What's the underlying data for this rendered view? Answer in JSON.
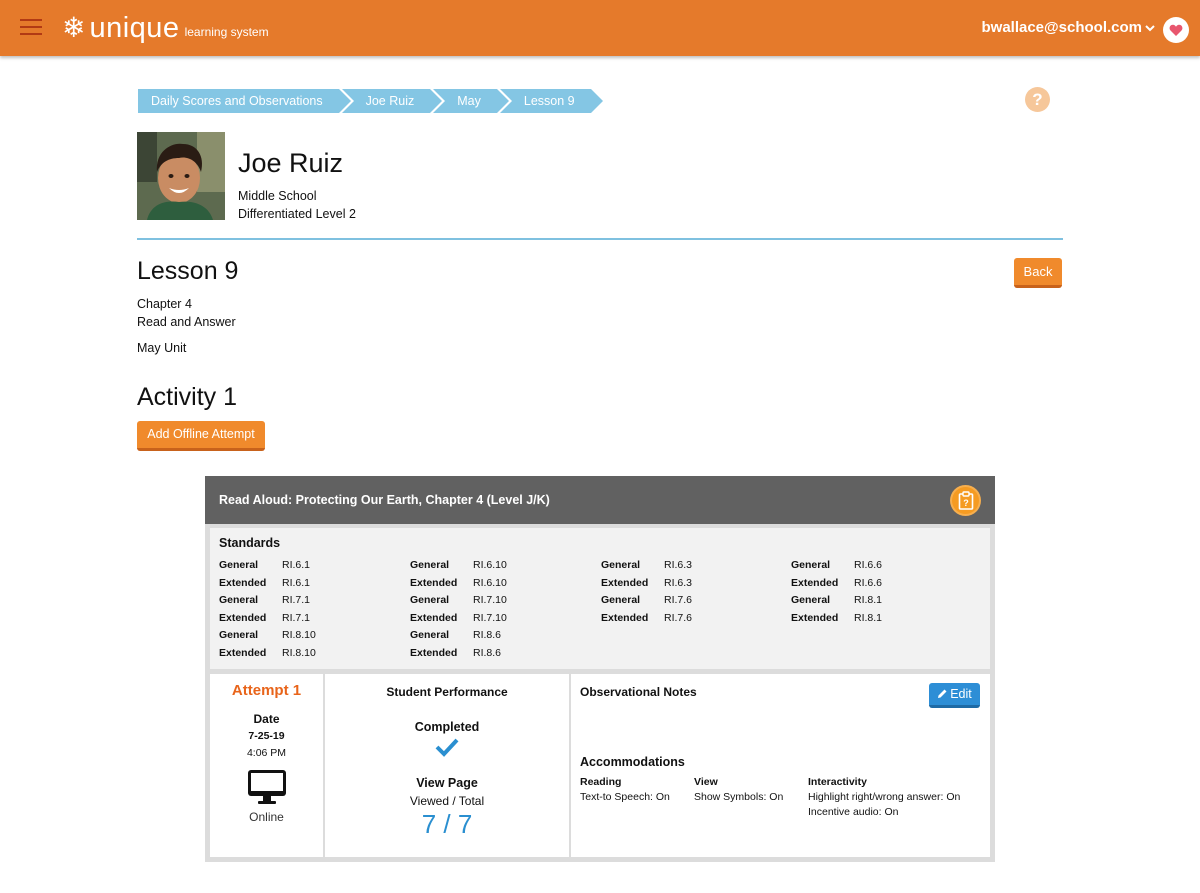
{
  "topbar": {
    "logo_main": "unique",
    "logo_sub": "learning system",
    "user_email": "bwallace@school.com"
  },
  "breadcrumb": [
    "Daily Scores and Observations",
    "Joe Ruiz",
    "May",
    "Lesson 9"
  ],
  "help": "?",
  "student": {
    "name": "Joe Ruiz",
    "school": "Middle School",
    "level": "Differentiated Level 2"
  },
  "lesson": {
    "title": "Lesson 9",
    "chapter": "Chapter 4",
    "type": "Read and Answer",
    "unit": "May Unit",
    "back_label": "Back"
  },
  "activity": {
    "title": "Activity 1",
    "add_offline_label": "Add Offline Attempt",
    "card_title": "Read Aloud: Protecting Our Earth, Chapter 4 (Level J/K)",
    "standards_title": "Standards",
    "standards": [
      [
        {
          "type": "General",
          "code": "RI.6.1"
        },
        {
          "type": "Extended",
          "code": "RI.6.1"
        },
        {
          "type": "General",
          "code": "RI.7.1"
        },
        {
          "type": "Extended",
          "code": "RI.7.1"
        },
        {
          "type": "General",
          "code": "RI.8.10"
        },
        {
          "type": "Extended",
          "code": "RI.8.10"
        }
      ],
      [
        {
          "type": "General",
          "code": "RI.6.10"
        },
        {
          "type": "Extended",
          "code": "RI.6.10"
        },
        {
          "type": "General",
          "code": "RI.7.10"
        },
        {
          "type": "Extended",
          "code": "RI.7.10"
        },
        {
          "type": "General",
          "code": "RI.8.6"
        },
        {
          "type": "Extended",
          "code": "RI.8.6"
        }
      ],
      [
        {
          "type": "General",
          "code": "RI.6.3"
        },
        {
          "type": "Extended",
          "code": "RI.6.3"
        },
        {
          "type": "General",
          "code": "RI.7.6"
        },
        {
          "type": "Extended",
          "code": "RI.7.6"
        }
      ],
      [
        {
          "type": "General",
          "code": "RI.6.6"
        },
        {
          "type": "Extended",
          "code": "RI.6.6"
        },
        {
          "type": "General",
          "code": "RI.8.1"
        },
        {
          "type": "Extended",
          "code": "RI.8.1"
        }
      ]
    ]
  },
  "attempt": {
    "title": "Attempt 1",
    "date_label": "Date",
    "date": "7-25-19",
    "time": "4:06 PM",
    "mode": "Online"
  },
  "performance": {
    "title": "Student Performance",
    "status": "Completed",
    "view_page_label": "View Page",
    "viewed_total_label": "Viewed / Total",
    "count": "7 / 7"
  },
  "notes": {
    "title": "Observational Notes",
    "edit_label": "Edit",
    "accommodations_title": "Accommodations",
    "columns": [
      {
        "heading": "Reading",
        "lines": [
          "Text-to Speech: On"
        ]
      },
      {
        "heading": "View",
        "lines": [
          "Show Symbols: On"
        ]
      },
      {
        "heading": "Interactivity",
        "lines": [
          "Highlight right/wrong answer: On",
          "Incentive audio: On"
        ]
      }
    ]
  },
  "colors": {
    "topbar": "#e57a2b",
    "breadcrumb": "#84c6e4",
    "button_orange": "#f08a2c",
    "attempt_orange": "#e8641a",
    "accent_blue": "#2a8fd0",
    "card_header": "#616161"
  },
  "icons": [
    "menu-icon",
    "snowflake-logo-icon",
    "chevron-down-icon",
    "heart-icon",
    "help-icon",
    "clipboard-icon",
    "monitor-icon",
    "checkmark-icon",
    "pencil-icon"
  ]
}
